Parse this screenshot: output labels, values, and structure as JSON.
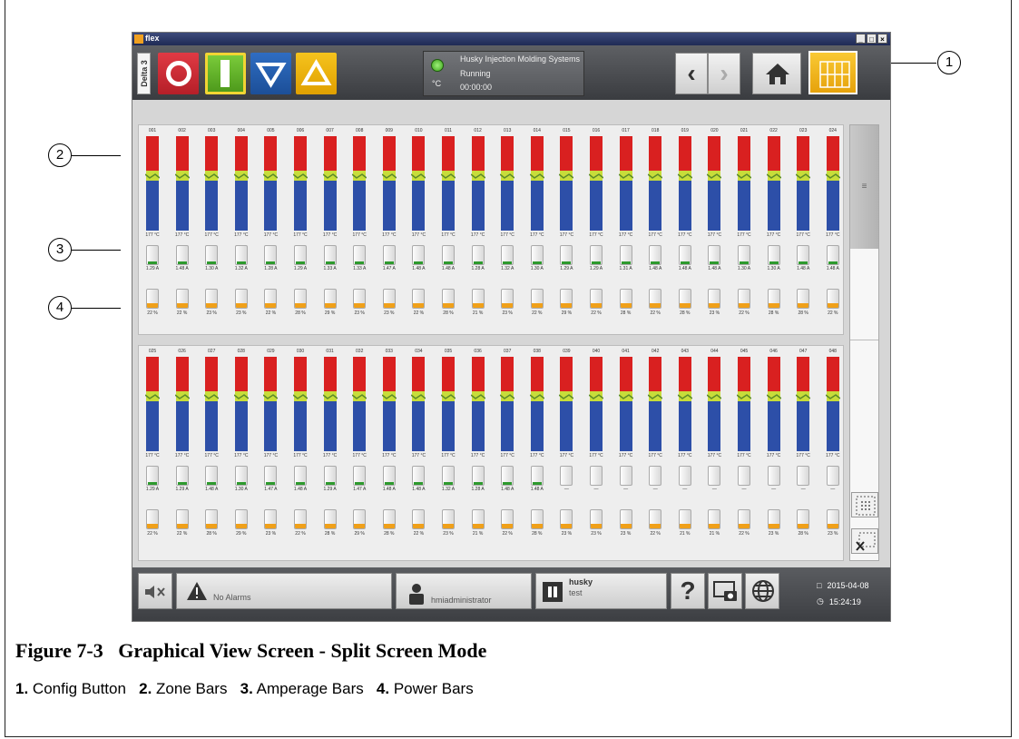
{
  "window": {
    "app_name": "flex",
    "controls": [
      "_",
      "□",
      "×"
    ]
  },
  "toolbar": {
    "delta_tab": "Delta 3",
    "buttons": [
      {
        "name": "stop",
        "color": "#cf2a33"
      },
      {
        "name": "start",
        "color": "#5fb22a"
      },
      {
        "name": "lower",
        "color": "#2560b4"
      },
      {
        "name": "raise",
        "color": "#f2b716"
      }
    ],
    "status": {
      "company": "Husky Injection Molding Systems",
      "state": "Running",
      "unit": "°C",
      "timer": "00:00:00"
    }
  },
  "zones": {
    "top": {
      "labels": [
        "001",
        "002",
        "003",
        "004",
        "005",
        "006",
        "007",
        "008",
        "009",
        "010",
        "011",
        "012",
        "013",
        "014",
        "015",
        "016",
        "017",
        "018",
        "019",
        "020",
        "021",
        "022",
        "023",
        "024"
      ],
      "temps": [
        "177 °C",
        "177 °C",
        "177 °C",
        "177 °C",
        "177 °C",
        "177 °C",
        "177 °C",
        "177 °C",
        "177 °C",
        "177 °C",
        "177 °C",
        "177 °C",
        "177 °C",
        "177 °C",
        "177 °C",
        "177 °C",
        "177 °C",
        "177 °C",
        "177 °C",
        "177 °C",
        "177 °C",
        "177 °C",
        "177 °C",
        "177 °C"
      ],
      "amps": [
        "1.29 A",
        "1.48 A",
        "1.30 A",
        "1.32 A",
        "1.28 A",
        "1.29 A",
        "1.33 A",
        "1.33 A",
        "1.47 A",
        "1.48 A",
        "1.48 A",
        "1.28 A",
        "1.32 A",
        "1.30 A",
        "1.29 A",
        "1.29 A",
        "1.31 A",
        "1.48 A",
        "1.48 A",
        "1.48 A",
        "1.30 A",
        "1.30 A",
        "1.48 A",
        "1.48 A"
      ],
      "powers": [
        "22 %",
        "22 %",
        "23 %",
        "23 %",
        "22 %",
        "28 %",
        "29 %",
        "23 %",
        "23 %",
        "22 %",
        "28 %",
        "21 %",
        "23 %",
        "22 %",
        "29 %",
        "22 %",
        "28 %",
        "22 %",
        "28 %",
        "23 %",
        "22 %",
        "28 %",
        "28 %",
        "22 %"
      ]
    },
    "bottom": {
      "labels": [
        "025",
        "026",
        "027",
        "028",
        "029",
        "030",
        "031",
        "032",
        "033",
        "034",
        "035",
        "036",
        "037",
        "038",
        "039",
        "040",
        "041",
        "042",
        "043",
        "044",
        "045",
        "046",
        "047",
        "048"
      ],
      "temps": [
        "177 °C",
        "177 °C",
        "177 °C",
        "177 °C",
        "177 °C",
        "177 °C",
        "177 °C",
        "177 °C",
        "177 °C",
        "177 °C",
        "177 °C",
        "177 °C",
        "177 °C",
        "177 °C",
        "177 °C",
        "177 °C",
        "177 °C",
        "177 °C",
        "177 °C",
        "177 °C",
        "177 °C",
        "177 °C",
        "177 °C",
        "177 °C"
      ],
      "amps": [
        "1.29 A",
        "1.29 A",
        "1.48 A",
        "1.30 A",
        "1.47 A",
        "1.48 A",
        "1.29 A",
        "1.47 A",
        "1.48 A",
        "1.48 A",
        "1.32 A",
        "1.28 A",
        "1.48 A",
        "1.48 A",
        "—",
        "—",
        "—",
        "—",
        "—",
        "—",
        "—",
        "—",
        "—",
        "—"
      ],
      "powers": [
        "22 %",
        "22 %",
        "28 %",
        "29 %",
        "23 %",
        "22 %",
        "28 %",
        "29 %",
        "28 %",
        "22 %",
        "23 %",
        "21 %",
        "22 %",
        "28 %",
        "23 %",
        "23 %",
        "23 %",
        "22 %",
        "21 %",
        "21 %",
        "22 %",
        "23 %",
        "28 %",
        "23 %"
      ]
    },
    "colors": {
      "set": "#d92020",
      "band": "#c7dd3a",
      "actual": "#2d4fa8",
      "amp_ok": "#2e9a2e",
      "power": "#f0a019"
    }
  },
  "scrollbar": {
    "thumb_glyph": "≡"
  },
  "statusbar": {
    "alarms": "No Alarms",
    "user": "hmiadministrator",
    "mold_name": "husky",
    "mold_sub": "test",
    "help": "?",
    "date": "2015-04-08",
    "time": "15:24:19"
  },
  "callouts": [
    "1",
    "2",
    "3",
    "4"
  ],
  "caption": {
    "number": "Figure 7-3",
    "title": "Graphical View Screen - Split Screen Mode"
  },
  "legend": [
    {
      "num": "1.",
      "text": "Config Button"
    },
    {
      "num": "2.",
      "text": "Zone Bars"
    },
    {
      "num": "3.",
      "text": "Amperage Bars"
    },
    {
      "num": "4.",
      "text": "Power Bars"
    }
  ]
}
